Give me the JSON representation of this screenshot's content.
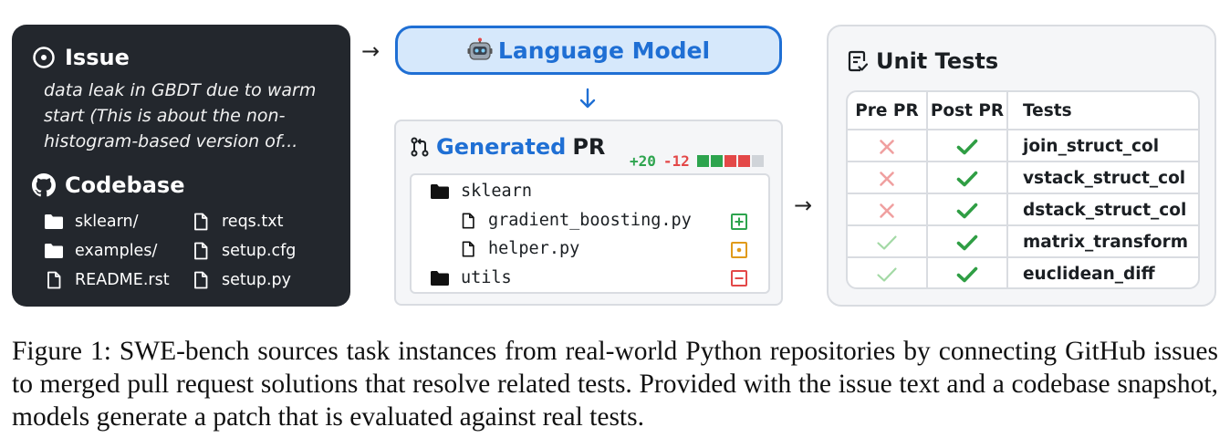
{
  "issue": {
    "heading": "Issue",
    "text": "data leak in GBDT due to warm start (This is about the non-histogram-based version of..."
  },
  "codebase": {
    "heading": "Codebase",
    "files": [
      {
        "name": "sklearn/",
        "kind": "folder",
        "icon": "folder-icon"
      },
      {
        "name": "examples/",
        "kind": "folder",
        "icon": "folder-icon"
      },
      {
        "name": "README.rst",
        "kind": "file",
        "icon": "file-icon"
      },
      {
        "name": "reqs.txt",
        "kind": "file",
        "icon": "file-icon"
      },
      {
        "name": "setup.cfg",
        "kind": "file",
        "icon": "file-icon"
      },
      {
        "name": "setup.py",
        "kind": "file",
        "icon": "file-icon"
      }
    ]
  },
  "model": {
    "label": "Language Model",
    "icon": "robot-icon"
  },
  "pr": {
    "title_highlight": "Generated",
    "title_rest": "PR",
    "additions": "+20",
    "deletions": "-12",
    "diff_blocks": [
      "green",
      "green",
      "red",
      "red",
      "gray"
    ],
    "tree": [
      {
        "name": "sklearn",
        "kind": "folder",
        "status": ""
      },
      {
        "name": "gradient_boosting.py",
        "kind": "file",
        "status": "added"
      },
      {
        "name": "helper.py",
        "kind": "file",
        "status": "modified"
      },
      {
        "name": "utils",
        "kind": "folder",
        "status": "removed"
      }
    ]
  },
  "unit_tests": {
    "title": "Unit Tests",
    "columns": [
      "Pre PR",
      "Post PR",
      "Tests"
    ],
    "rows": [
      {
        "pre": "fail",
        "post": "pass",
        "test": "join_struct_col"
      },
      {
        "pre": "fail",
        "post": "pass",
        "test": "vstack_struct_col"
      },
      {
        "pre": "fail",
        "post": "pass",
        "test": "dstack_struct_col"
      },
      {
        "pre": "pass",
        "post": "pass",
        "test": "matrix_transform"
      },
      {
        "pre": "pass",
        "post": "pass",
        "test": "euclidean_diff"
      }
    ]
  },
  "caption": "Figure 1: SWE-bench sources task instances from real-world Python repositories by connecting GitHub issues to merged pull request solutions that resolve related tests. Provided with the issue text and a codebase snapshot, models generate a patch that is evaluated against real tests.",
  "colors": {
    "accent_blue": "#1f6fd4",
    "model_fill": "#d6e8fb",
    "pass_green": "#2f9e44",
    "fail_red": "#f0a0a0",
    "prev_pass": "#a3d9a5",
    "added_green": "#2da44e",
    "modified_orange": "#e09a1a",
    "removed_red": "#e34848"
  }
}
